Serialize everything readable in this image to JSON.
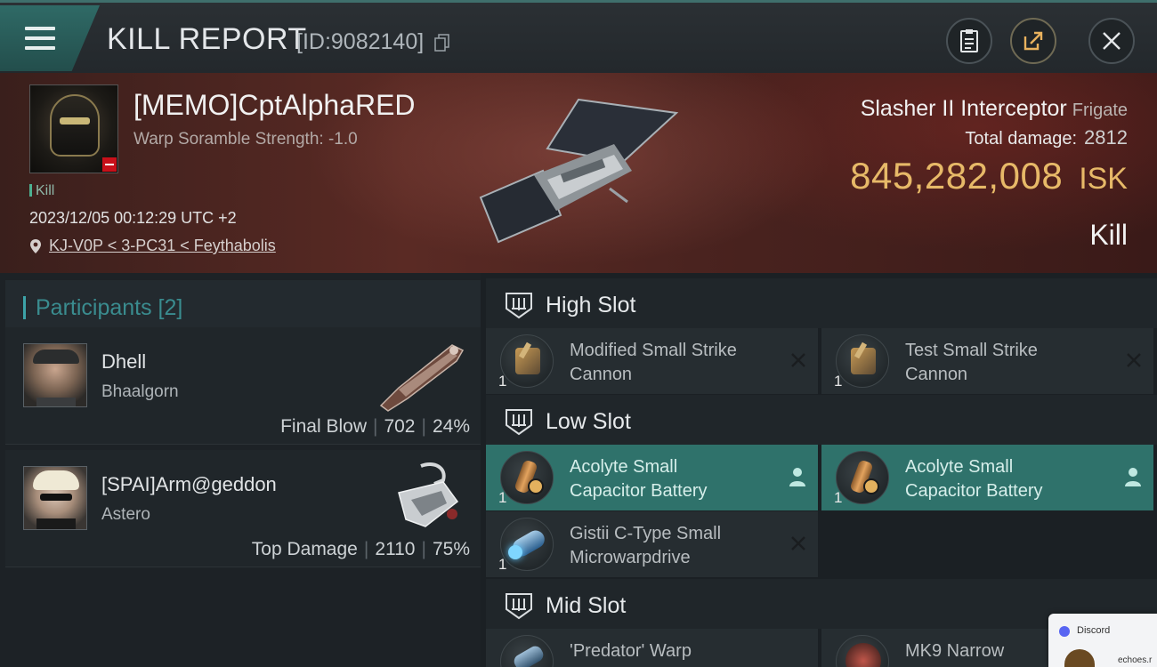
{
  "header": {
    "title": "KILL REPORT",
    "report_id": "[ID:9082140]"
  },
  "victim": {
    "name": "[MEMO]CptAlphaRED",
    "warp_scramble": "Warp Soramble Strength: -1.0",
    "tag": "Kill",
    "datetime": "2023/12/05 00:12:29 UTC +2",
    "location": "KJ-V0P < 3-PC31 < Feythabolis"
  },
  "ship": {
    "name": "Slasher II Interceptor",
    "class": "Frigate",
    "damage_label": "Total damage:",
    "damage_value": "2812",
    "isk_value": "845,282,008",
    "isk_unit": "ISK",
    "result": "Kill"
  },
  "participants": {
    "title": "Participants [2]",
    "items": [
      {
        "name": "Dhell",
        "ship": "Bhaalgorn",
        "role": "Final Blow",
        "damage": "702",
        "percent": "24%"
      },
      {
        "name": "[SPAI]Arm@geddon",
        "ship": "Astero",
        "role": "Top Damage",
        "damage": "2110",
        "percent": "75%"
      }
    ]
  },
  "fitting": {
    "high_slot": {
      "label": "High Slot",
      "modules": [
        {
          "name_line1": "Modified Small Strike",
          "name_line2": "Cannon",
          "qty": "1"
        },
        {
          "name_line1": "Test Small Strike",
          "name_line2": "Cannon",
          "qty": "1"
        }
      ]
    },
    "low_slot": {
      "label": "Low Slot",
      "modules": [
        {
          "name_line1": "Acolyte Small",
          "name_line2": "Capacitor Battery",
          "qty": "1"
        },
        {
          "name_line1": "Acolyte Small",
          "name_line2": "Capacitor Battery",
          "qty": "1"
        },
        {
          "name_line1": "Gistii C-Type Small",
          "name_line2": "Microwarpdrive",
          "qty": "1"
        }
      ]
    },
    "mid_slot": {
      "label": "Mid Slot",
      "modules": [
        {
          "name_line1": "'Predator' Warp"
        },
        {
          "name_line1": "MK9 Narrow"
        }
      ]
    }
  },
  "discord": {
    "name": "Discord",
    "host": "echoes.r"
  },
  "colors": {
    "accent_teal": "#2f726b",
    "isk_gold": "#e7b968",
    "loss_red": "#c8101a"
  }
}
